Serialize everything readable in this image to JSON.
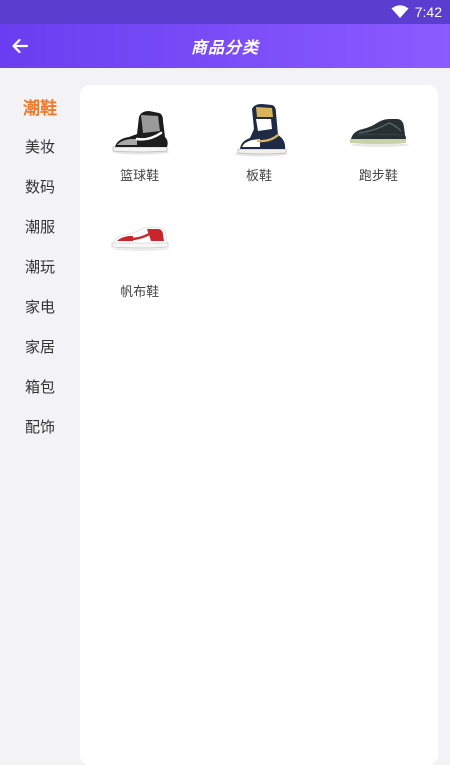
{
  "status_bar": {
    "time": "7:42",
    "wifi_icon": "wifi-icon"
  },
  "header": {
    "title": "商品分类",
    "back_icon": "arrow-left-icon"
  },
  "colors": {
    "header_start": "#6a3ef0",
    "header_end": "#8b5bff",
    "active_category": "#f07a2a"
  },
  "sidebar": {
    "items": [
      {
        "label": "潮鞋",
        "active": true
      },
      {
        "label": "美妆"
      },
      {
        "label": "数码"
      },
      {
        "label": "潮服"
      },
      {
        "label": "潮玩"
      },
      {
        "label": "家电"
      },
      {
        "label": "家居"
      },
      {
        "label": "箱包"
      },
      {
        "label": "配饰"
      }
    ]
  },
  "products": [
    {
      "name": "篮球鞋",
      "image": "high-top-sneaker-grey"
    },
    {
      "name": "板鞋",
      "image": "high-top-sneaker-navy-gold"
    },
    {
      "name": "跑步鞋",
      "image": "knit-running-shoe-dark"
    },
    {
      "name": "帆布鞋",
      "image": "low-top-sneaker-red"
    }
  ]
}
